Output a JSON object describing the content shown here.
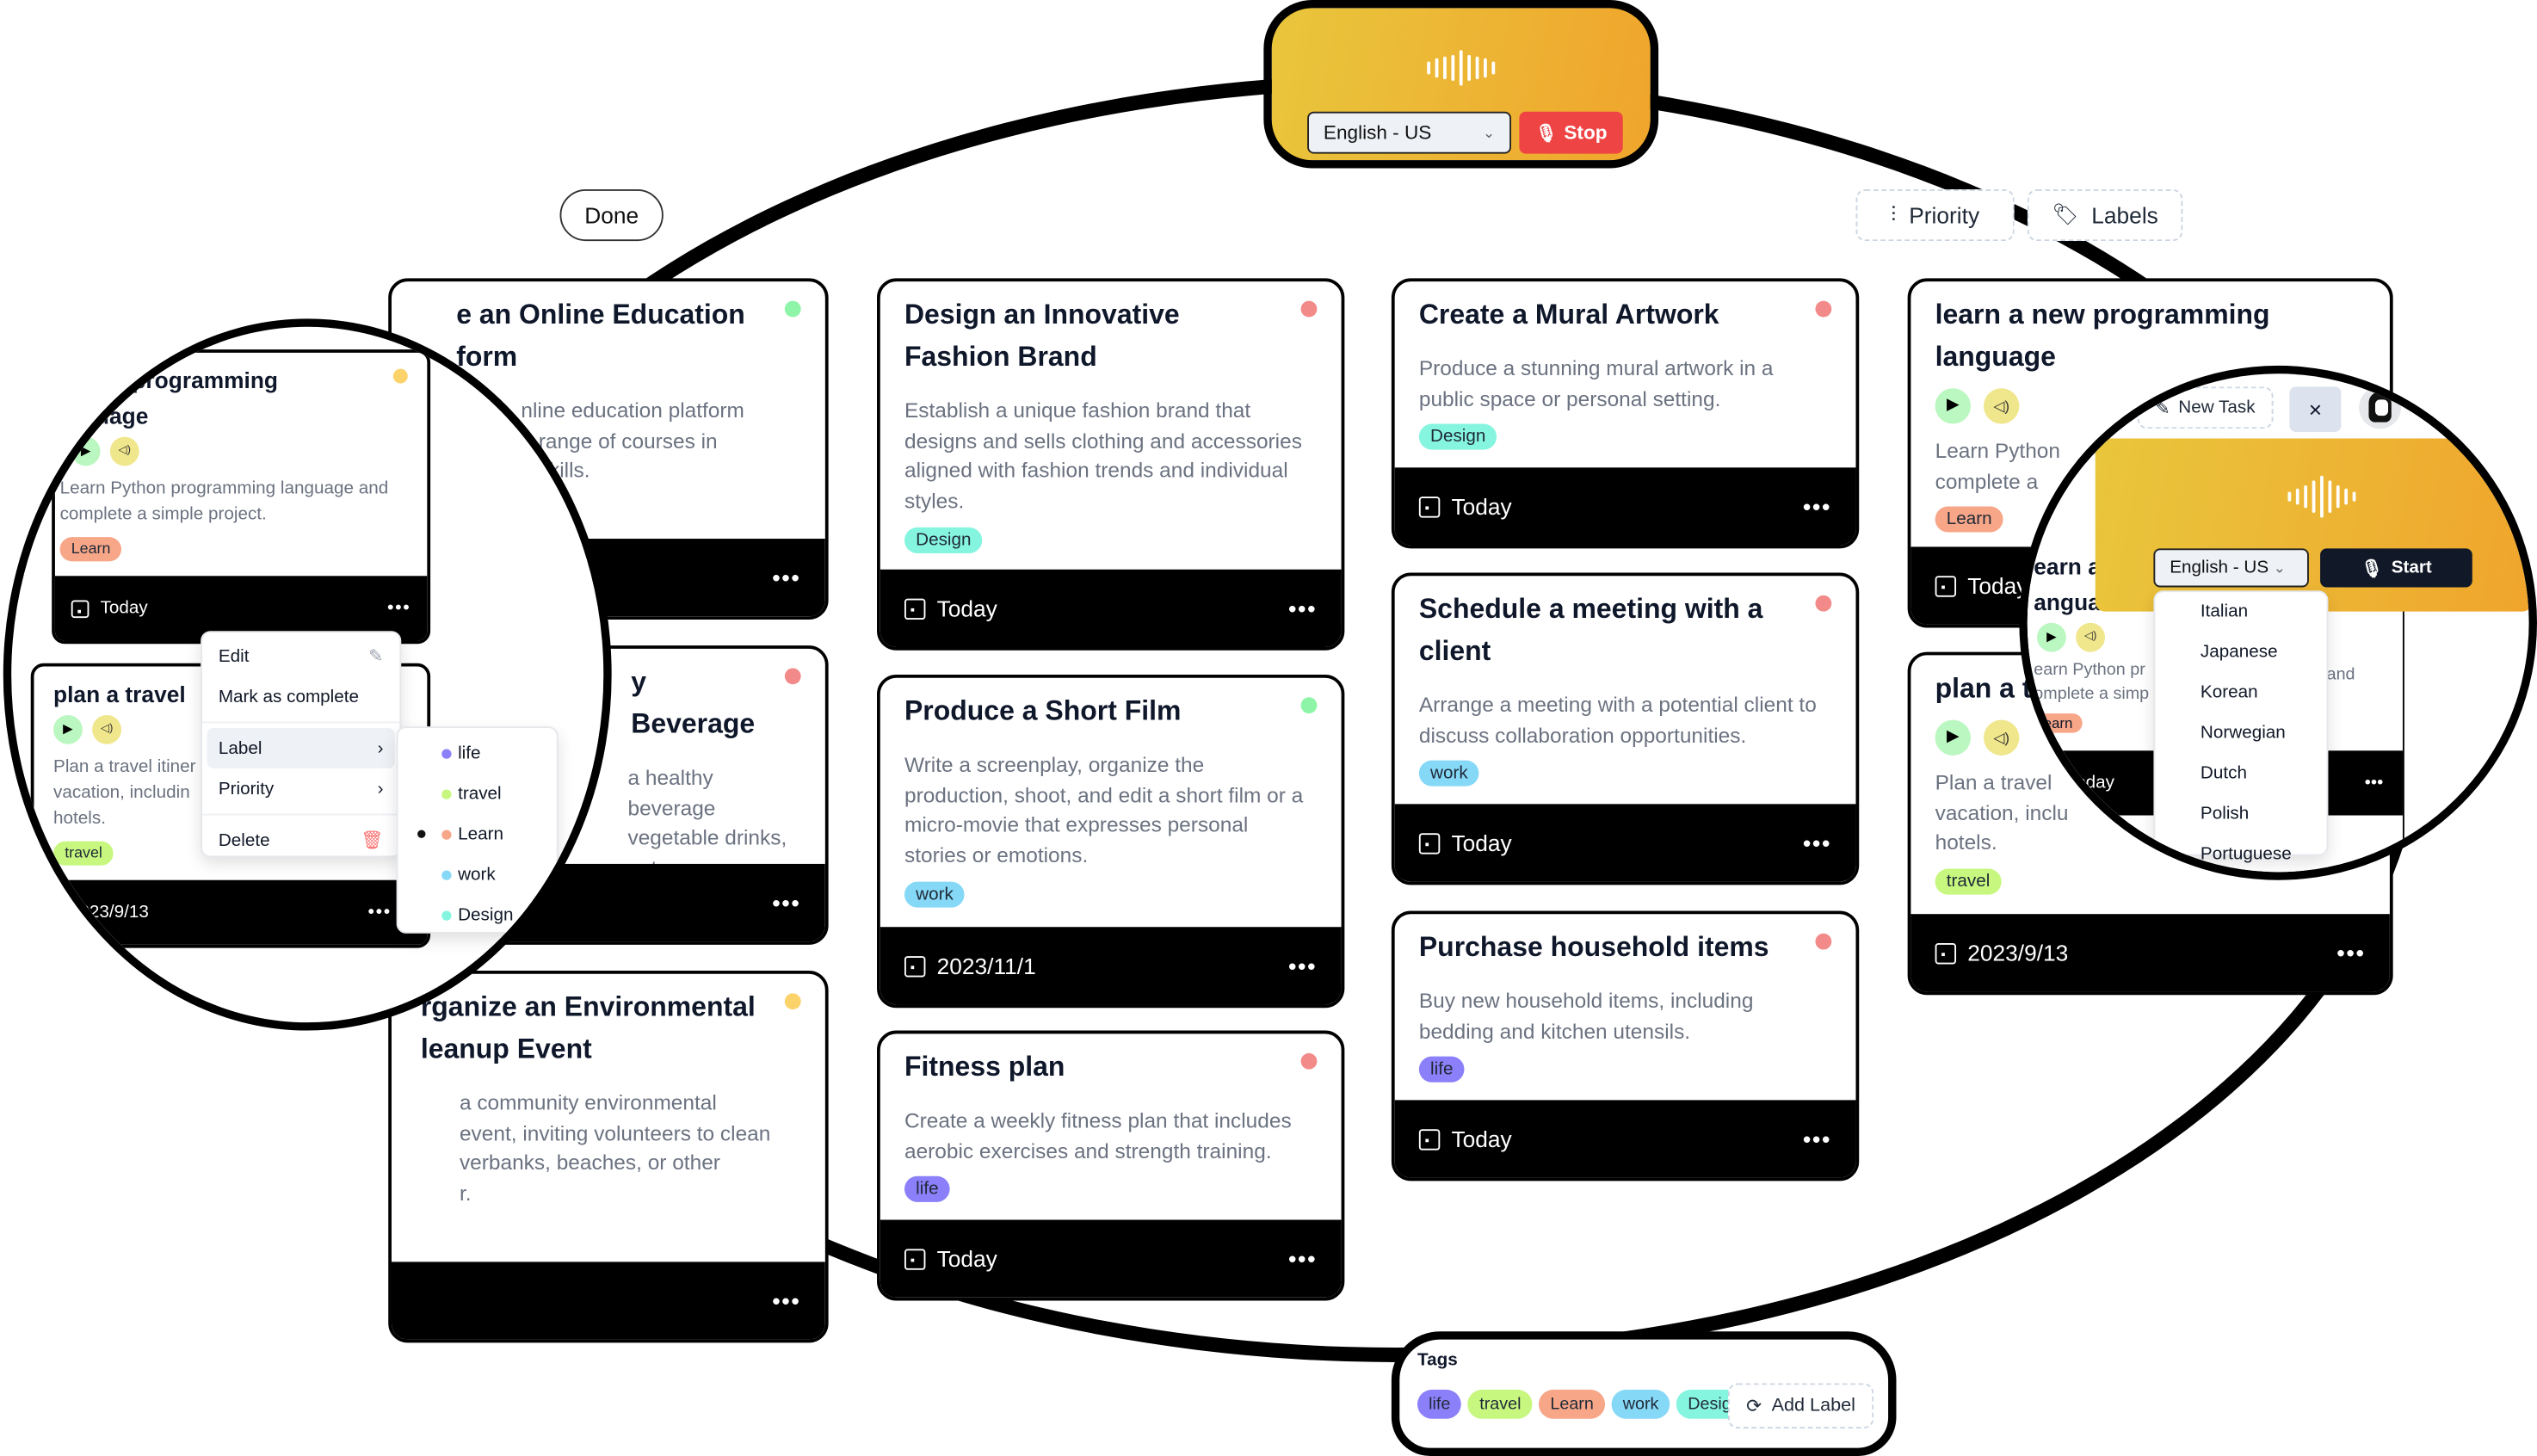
{
  "voice_top": {
    "language": "English - US",
    "stop_label": "Stop"
  },
  "toolbar": {
    "done_label": "Done",
    "priority_label": "Priority",
    "labels_label": "Labels"
  },
  "colors": {
    "accent_gradient_start": "#e9c63c",
    "accent_gradient_end": "#f0a52c",
    "stop_red": "#ef4444",
    "start_dark": "#111827",
    "priority_high": "#f38a8a",
    "priority_medium": "#fcd26a",
    "priority_low": "#8ef5a8",
    "tag_life": "#8b80f9",
    "tag_travel": "#c7f77f",
    "tag_learn": "#f7a688",
    "tag_work": "#86d8f7",
    "tag_design": "#86f5e0"
  },
  "columns": [
    {
      "cards": [
        {
          "title": "Create an Online Education Platform",
          "title_visible": "e an Online Education\nform",
          "desc": "…nline education platform …e range of courses in …d skills.",
          "priority": "low",
          "tag": "",
          "date": ""
        },
        {
          "title": "…y Beverage",
          "desc": "…a healthy beverage …vegetable drinks, …ents.",
          "priority": "high",
          "tag": "",
          "date": ""
        },
        {
          "title": "Organize an Environmental Cleanup Event",
          "title_visible": "rganize an Environmental\nleanup Event",
          "desc": "…a community environmental …event, inviting volunteers to clean …verbanks, beaches, or other …r.",
          "priority": "medium",
          "tag": "",
          "date": ""
        }
      ]
    },
    {
      "cards": [
        {
          "title": "Design an Innovative Fashion Brand",
          "desc": "Establish a unique fashion brand that designs and sells clothing and accessories aligned with fashion trends and individual styles.",
          "priority": "high",
          "tag": "Design",
          "date": "Today"
        },
        {
          "title": "Produce a Short Film",
          "desc": "Write a screenplay, organize the production, shoot, and edit a short film or a micro-movie that expresses personal stories or emotions.",
          "priority": "low",
          "tag": "work",
          "date": "2023/11/1"
        },
        {
          "title": "Fitness plan",
          "desc": "Create a weekly fitness plan that includes aerobic exercises and strength training.",
          "priority": "high",
          "tag": "life",
          "date": "Today"
        }
      ]
    },
    {
      "cards": [
        {
          "title": "Create a Mural Artwork",
          "desc": "Produce a stunning mural artwork in a public space or personal setting.",
          "priority": "high",
          "tag": "Design",
          "date": "Today"
        },
        {
          "title": "Schedule a meeting with a client",
          "desc": "Arrange a meeting with a potential client to discuss collaboration opportunities.",
          "priority": "high",
          "tag": "work",
          "date": "Today"
        },
        {
          "title": "Purchase household items",
          "desc": "Buy new household items, including bedding and kitchen utensils.",
          "priority": "high",
          "tag": "life",
          "date": "Today"
        }
      ]
    },
    {
      "cards": [
        {
          "title": "learn a new programming language",
          "desc": "Learn Python programming language and complete a simple project.",
          "desc_visible": "Learn Python\ncomplete a",
          "priority": "medium",
          "tag": "Learn",
          "date": "Today"
        },
        {
          "title": "plan a travel",
          "title_visible": "plan a t",
          "desc": "Plan a travel itinerary for your vacation, including hotels.",
          "desc_visible": "Plan a travel\nvacation, inclu\nhotels.",
          "priority": "high",
          "tag": "travel",
          "date": "2023/9/13"
        }
      ]
    }
  ],
  "left_lens": {
    "card1": {
      "title_visible": "…ew programming\n…uage",
      "desc": "Learn Python programming language and complete a simple project.",
      "tag": "Learn",
      "date": "Today"
    },
    "card2": {
      "title": "plan a travel",
      "desc_visible": "Plan a travel itiner…\nvacation, including…\nhotels.",
      "tag": "travel",
      "date": "2023/9/13"
    },
    "context_menu": {
      "edit": "Edit",
      "mark_complete": "Mark as complete",
      "label": "Label",
      "priority": "Priority",
      "delete": "Delete"
    },
    "label_submenu": [
      {
        "name": "life",
        "selected": false
      },
      {
        "name": "travel",
        "selected": false
      },
      {
        "name": "Learn",
        "selected": true
      },
      {
        "name": "work",
        "selected": false
      },
      {
        "name": "Design",
        "selected": false
      }
    ]
  },
  "right_lens": {
    "new_task_label": "New Task",
    "close_label": "×",
    "language": "English - US",
    "start_label": "Start",
    "language_options": [
      "Italian",
      "Japanese",
      "Korean",
      "Norwegian",
      "Dutch",
      "Polish",
      "Portuguese"
    ],
    "bg_card": {
      "title_visible": "earn a\nangua",
      "desc_visible": "earn Python p…          and\nomplete a sim…",
      "tag": "Learn",
      "date_visible": "oday"
    }
  },
  "tags_panel": {
    "title": "Tags",
    "tags": [
      "life",
      "travel",
      "Learn",
      "work",
      "Design"
    ],
    "add_label": "Add Label"
  }
}
